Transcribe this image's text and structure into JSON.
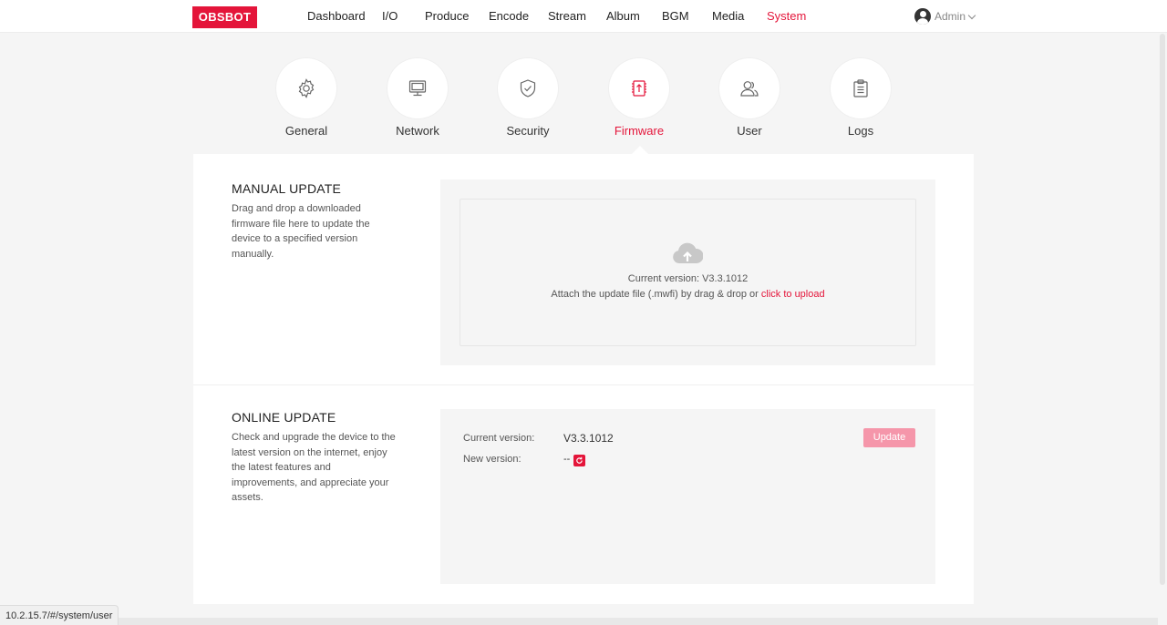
{
  "brand": {
    "logo_text": "OBSBOT",
    "accent": "#e4153a"
  },
  "nav": {
    "items": [
      {
        "label": "Dashboard"
      },
      {
        "label": "I/O"
      },
      {
        "label": "Produce"
      },
      {
        "label": "Encode"
      },
      {
        "label": "Stream"
      },
      {
        "label": "Album"
      },
      {
        "label": "BGM"
      },
      {
        "label": "Media"
      },
      {
        "label": "System",
        "active": true
      }
    ],
    "user": {
      "name": "Admin",
      "icon": "user-avatar-icon"
    }
  },
  "tabs": [
    {
      "label": "General",
      "icon": "gear-icon"
    },
    {
      "label": "Network",
      "icon": "monitor-icon"
    },
    {
      "label": "Security",
      "icon": "shield-check-icon"
    },
    {
      "label": "Firmware",
      "icon": "chip-upload-icon",
      "active": true
    },
    {
      "label": "User",
      "icon": "users-icon"
    },
    {
      "label": "Logs",
      "icon": "clipboard-icon"
    }
  ],
  "manual_update": {
    "title": "MANUAL UPDATE",
    "description": "Drag and drop a downloaded firmware file here to update the device to a specified version manually.",
    "current_version_text": "Current version: V3.3.1012",
    "attach_text": "Attach the update file (.mwfi) by drag & drop or ",
    "upload_link": "click to upload",
    "icon": "cloud-upload-icon"
  },
  "online_update": {
    "title": "ONLINE UPDATE",
    "description": "Check and upgrade the device to the latest version on the internet, enjoy the latest features and improvements, and appreciate your assets.",
    "current_version_label": "Current version:",
    "current_version_value": "V3.3.1012",
    "new_version_label": "New version:",
    "new_version_value": "--",
    "update_button": "Update"
  },
  "status_bar": {
    "url": "10.2.15.7/#/system/user"
  }
}
